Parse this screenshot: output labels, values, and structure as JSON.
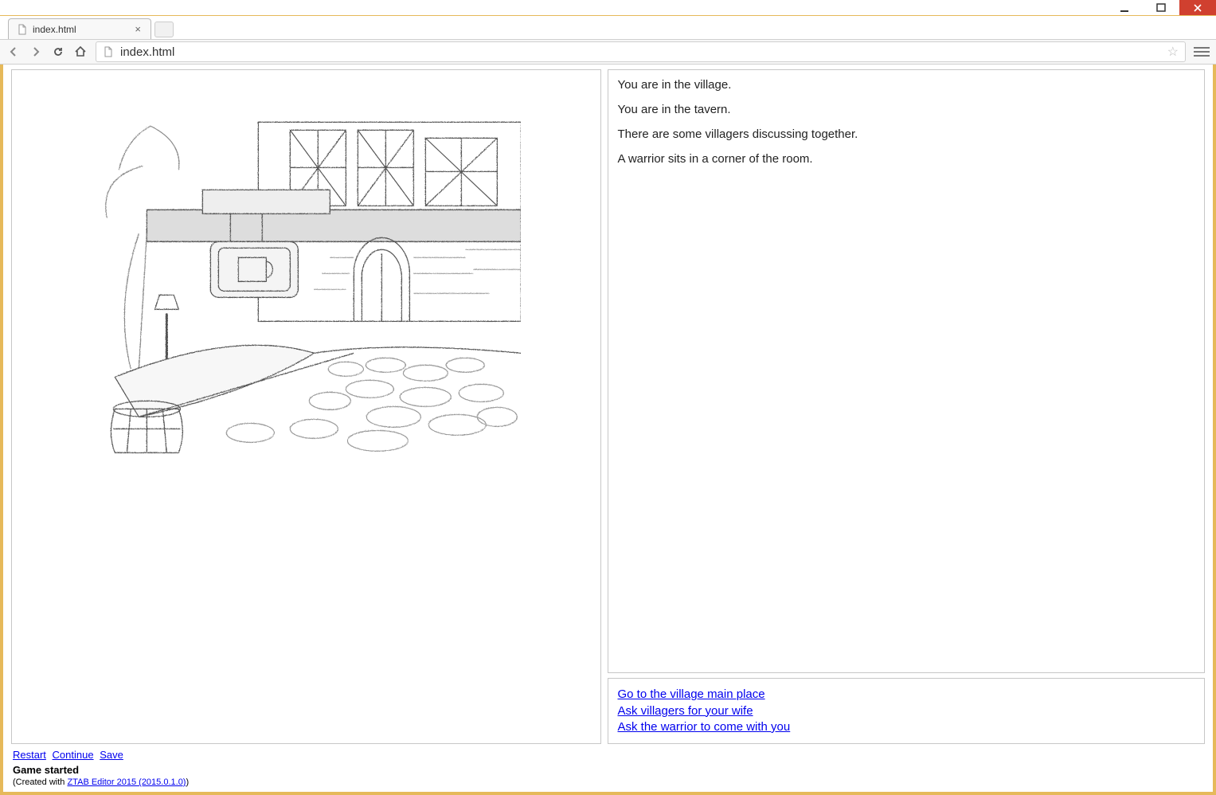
{
  "window": {
    "tab_title": "index.html",
    "url_display": "index.html"
  },
  "story": {
    "paragraphs": [
      "You are in the village.",
      "You are in the tavern.",
      "There are some villagers discussing together.",
      "A warrior sits in a corner of the room."
    ]
  },
  "choices": [
    "Go to the village main place",
    "Ask villagers for your wife",
    "Ask the warrior to come with you"
  ],
  "footer": {
    "restart": "Restart",
    "continue": "Continue",
    "save": "Save",
    "status": "Game started",
    "credit_prefix": "(Created with ",
    "credit_link": "ZTAB Editor 2015 (2015.0.1.0)",
    "credit_suffix": ")"
  }
}
